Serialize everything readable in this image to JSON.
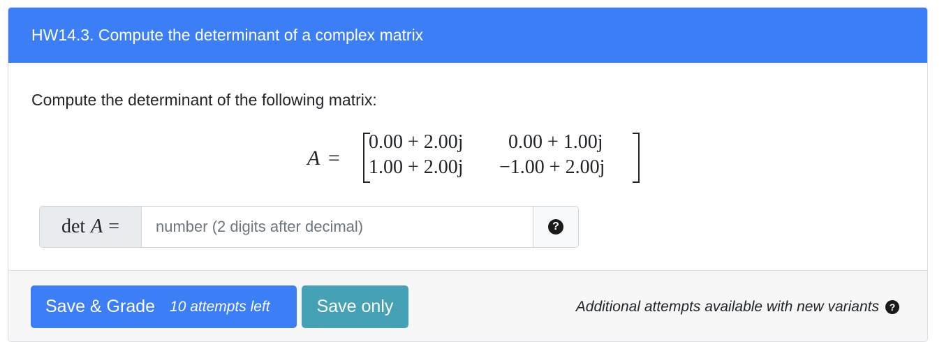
{
  "header": {
    "title": "HW14.3. Compute the determinant of a complex matrix"
  },
  "body": {
    "prompt": "Compute the determinant of the following matrix:",
    "matrix": {
      "lhs": "A",
      "eq": "=",
      "cells": {
        "r1c1": "0.00 + 2.00j",
        "r1c2": "0.00 + 1.00j",
        "r2c1": "1.00 + 2.00j",
        "r2c2": "−1.00 + 2.00j"
      }
    },
    "answer": {
      "label_op": "det",
      "label_var": "A",
      "label_eq": "=",
      "value": "",
      "placeholder": "number (2 digits after decimal)",
      "help_icon": "question-circle-icon"
    }
  },
  "footer": {
    "save_grade_label": "Save & Grade",
    "attempts_left": "10 attempts left",
    "save_only_label": "Save only",
    "note": "Additional attempts available with new variants",
    "note_icon": "question-circle-icon"
  },
  "colors": {
    "primary": "#3b7ef6",
    "info": "#45a1b5",
    "footer_bg": "#f7f7f7"
  }
}
